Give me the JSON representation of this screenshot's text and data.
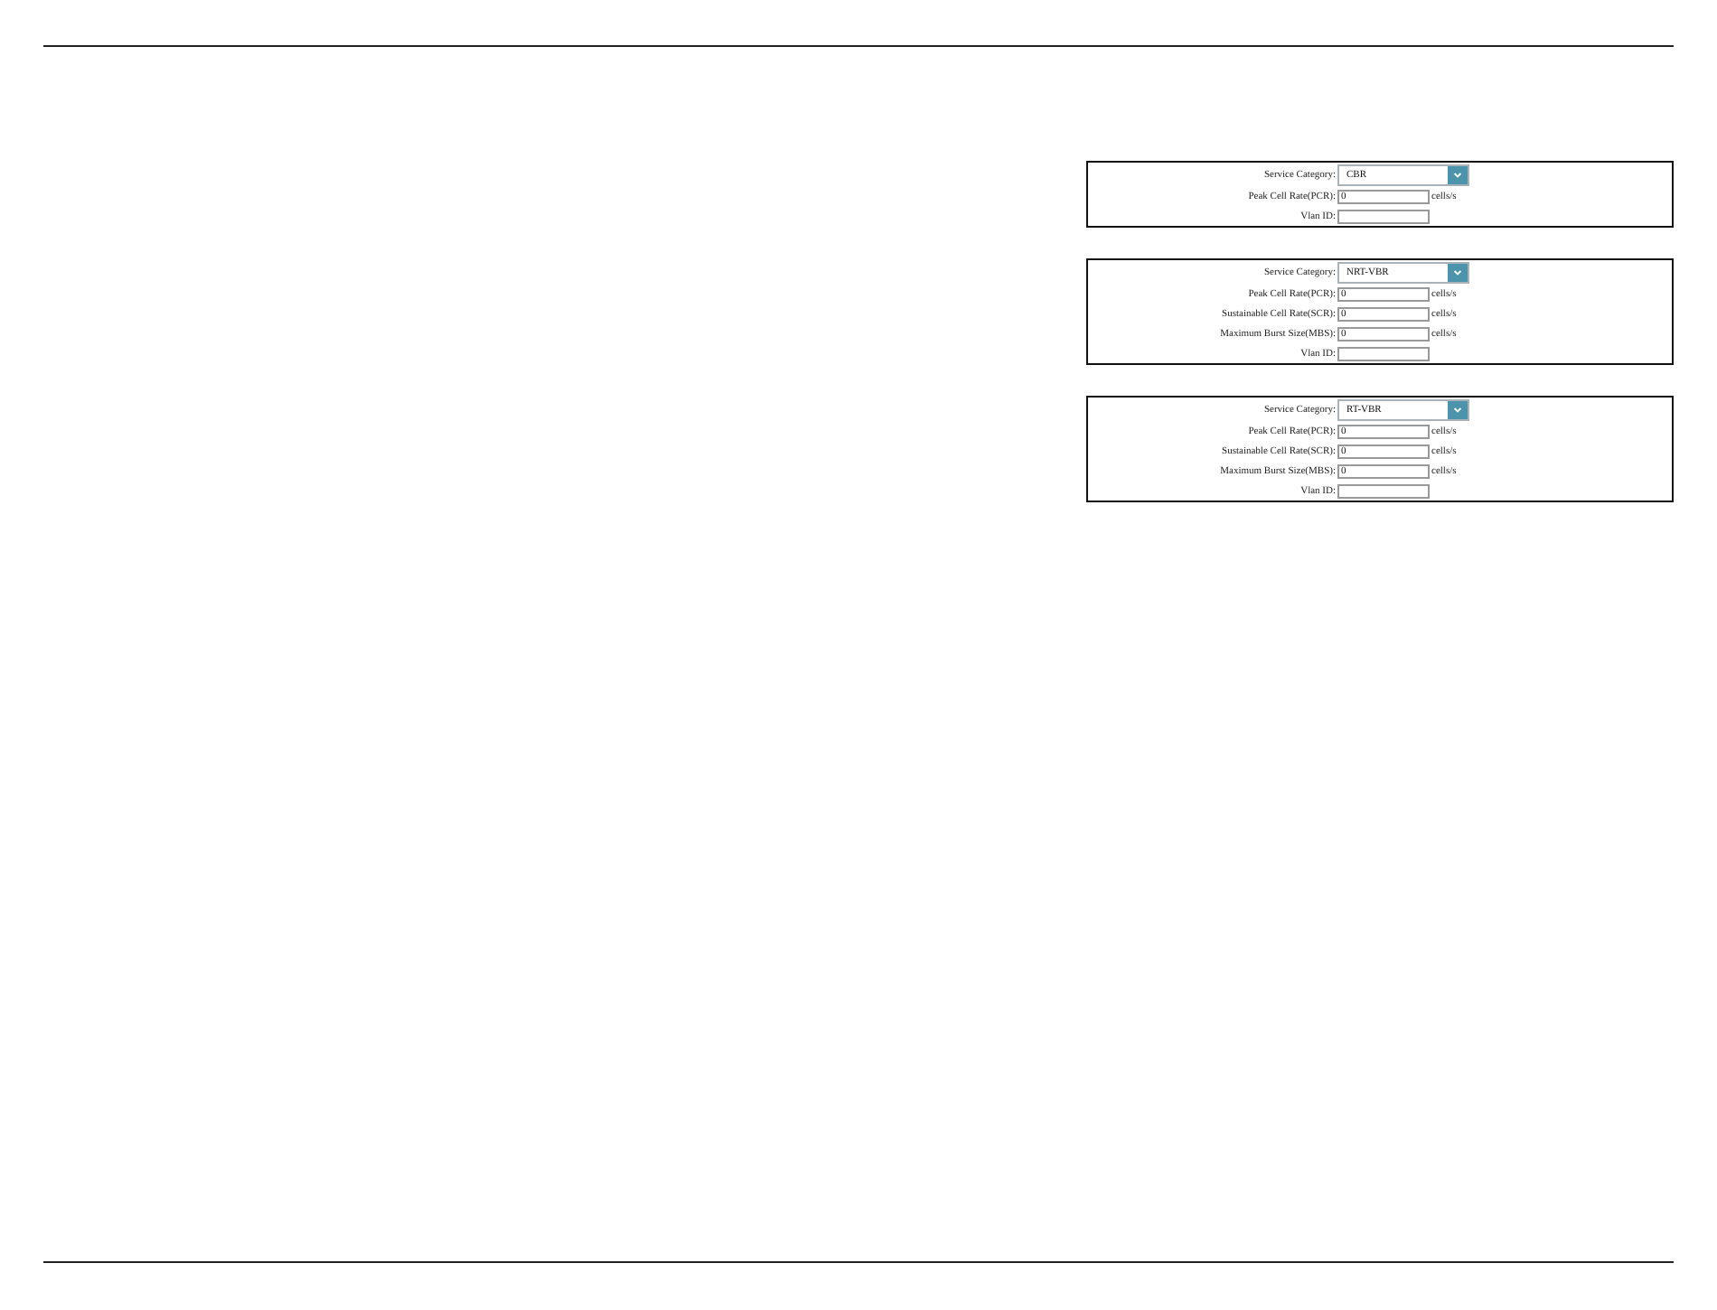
{
  "panels": [
    {
      "fields": [
        {
          "kind": "select",
          "label": "Service Category:",
          "value": "CBR"
        },
        {
          "kind": "input",
          "label": "Peak Cell Rate(PCR):",
          "value": "0",
          "unit": "cells/s"
        },
        {
          "kind": "input",
          "label": "Vlan ID:"
        }
      ]
    },
    {
      "fields": [
        {
          "kind": "select",
          "label": "Service Category:",
          "value": "NRT-VBR"
        },
        {
          "kind": "input",
          "label": "Peak Cell Rate(PCR):",
          "value": "0",
          "unit": "cells/s"
        },
        {
          "kind": "input",
          "label": "Sustainable Cell Rate(SCR):",
          "value": "0",
          "unit": "cells/s"
        },
        {
          "kind": "input",
          "label": "Maximum Burst Size(MBS):",
          "value": "0",
          "unit": "cells/s"
        },
        {
          "kind": "input",
          "label": "Vlan ID:"
        }
      ]
    },
    {
      "fields": [
        {
          "kind": "select",
          "label": "Service Category:",
          "value": "RT-VBR"
        },
        {
          "kind": "input",
          "label": "Peak Cell Rate(PCR):",
          "value": "0",
          "unit": "cells/s"
        },
        {
          "kind": "input",
          "label": "Sustainable Cell Rate(SCR):",
          "value": "0",
          "unit": "cells/s"
        },
        {
          "kind": "input",
          "label": "Maximum Burst Size(MBS):",
          "value": "0",
          "unit": "cells/s"
        },
        {
          "kind": "input",
          "label": "Vlan ID:"
        }
      ]
    }
  ]
}
